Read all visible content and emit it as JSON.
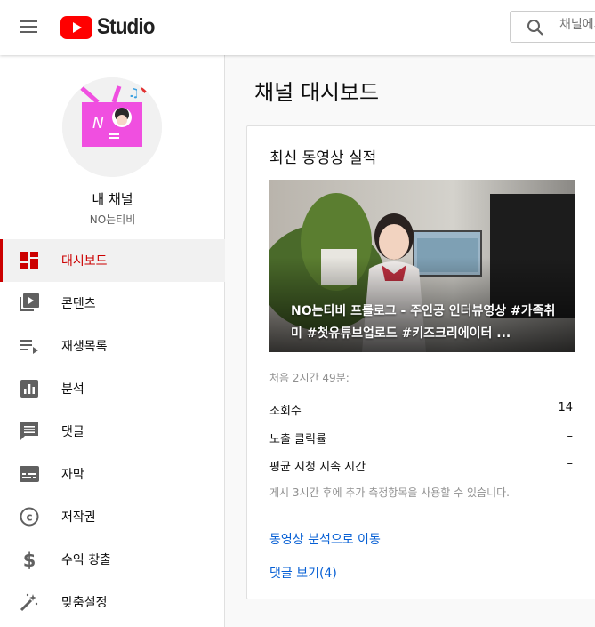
{
  "header": {
    "logo_text": "Studio",
    "search_placeholder": "채널에서 검색"
  },
  "sidebar": {
    "channel_label": "내 채널",
    "channel_name": "NO는티비",
    "items": [
      {
        "label": "대시보드",
        "icon": "dashboard-icon",
        "active": true
      },
      {
        "label": "콘텐츠",
        "icon": "videos-icon",
        "active": false
      },
      {
        "label": "재생목록",
        "icon": "playlist-icon",
        "active": false
      },
      {
        "label": "분석",
        "icon": "analytics-icon",
        "active": false
      },
      {
        "label": "댓글",
        "icon": "comments-icon",
        "active": false
      },
      {
        "label": "자막",
        "icon": "subtitles-icon",
        "active": false
      },
      {
        "label": "저작권",
        "icon": "copyright-icon",
        "active": false
      },
      {
        "label": "수익 창출",
        "icon": "monetization-icon",
        "active": false
      },
      {
        "label": "맞춤설정",
        "icon": "customization-icon",
        "active": false
      }
    ]
  },
  "main": {
    "page_title": "채널 대시보드",
    "card": {
      "title": "최신 동영상 실적",
      "video_title": "NO는티비 프롤로그 - 주인공 인터뷰영상 #가족취미 #첫유튜브업로드 #키즈크리에이터 ...",
      "first_period": "처음 2시간 49분:",
      "stats": [
        {
          "label": "조회수",
          "value": "14"
        },
        {
          "label": "노출 클릭률",
          "value": "–"
        },
        {
          "label": "평균 시청 지속 시간",
          "value": "–"
        }
      ],
      "note": "게시 3시간 후에 추가 측정항목을 사용할 수 있습니다.",
      "analytics_link": "동영상 분석으로 이동",
      "comments_link": "댓글 보기(4)"
    }
  },
  "colors": {
    "brand_red": "#ff0000",
    "active_red": "#cc0000",
    "link_blue": "#065fd4"
  }
}
